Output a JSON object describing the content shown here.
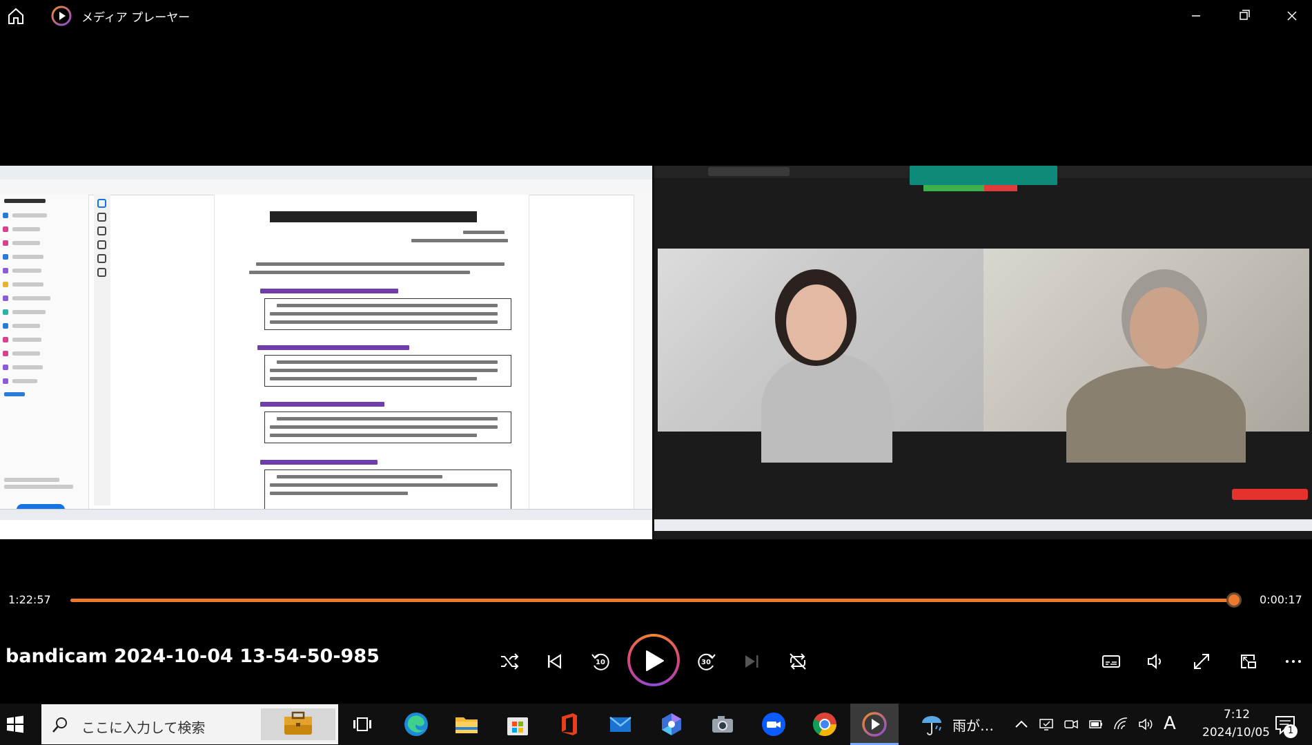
{
  "app": {
    "title": "メディア プレーヤー"
  },
  "playback": {
    "current_time": "1:22:57",
    "remaining_time": "0:00:17",
    "progress_fraction": 0.9975,
    "file_name": "bandicam 2024-10-04 13-54-50-985",
    "skip_back_seconds": "10",
    "skip_forward_seconds": "30"
  },
  "taskbar": {
    "search_placeholder": "ここに入力して検索",
    "weather_text": "雨が…",
    "ime_indicator": "A",
    "clock_time": "7:12",
    "clock_date": "2024/10/05",
    "notification_count": "1"
  },
  "colors": {
    "accent_orange": "#ec7a2c",
    "accent_purple": "#8d4ad8",
    "background": "#000000"
  }
}
